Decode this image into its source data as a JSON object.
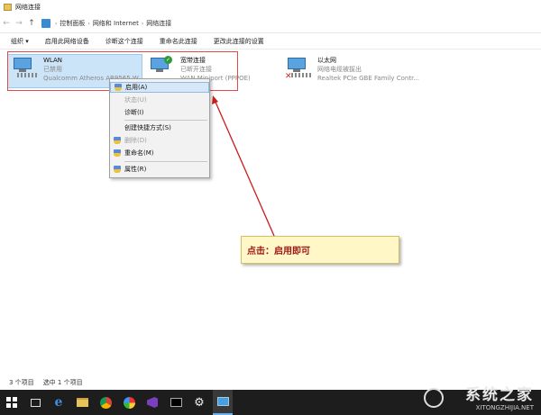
{
  "window": {
    "title": "网络连接"
  },
  "address": {
    "breadcrumbs": [
      "控制面板",
      "网络和 Internet",
      "网络连接"
    ]
  },
  "commands": [
    "组织 ▾",
    "启用此网络设备",
    "诊断这个连接",
    "重命名此连接",
    "更改此连接的设置"
  ],
  "connections": [
    {
      "name": "WLAN",
      "status": "已禁用",
      "device": "Qualcomm Atheros AR9565 W..."
    },
    {
      "name": "宽带连接",
      "status": "已断开连接",
      "device": "WAN Miniport (PPPOE)"
    },
    {
      "name": "以太网",
      "status": "网络电缆被拔出",
      "device": "Realtek PCIe GBE Family Contr..."
    }
  ],
  "context_menu": [
    {
      "label": "启用(A)"
    },
    {
      "label": "状态(U)"
    },
    {
      "label": "诊断(I)"
    },
    {
      "label": "创建快捷方式(S)"
    },
    {
      "label": "删除(D)"
    },
    {
      "label": "重命名(M)"
    },
    {
      "label": "属性(R)"
    }
  ],
  "callout": {
    "text": "点击：启用即可"
  },
  "status_bar": {
    "count": "3 个项目",
    "selected": "选中 1 个项目"
  },
  "watermark": {
    "title": "系统之家",
    "url": "XITONGZHIJIA.NET"
  },
  "colors": {
    "annotation_red": "#e24a4a",
    "callout_bg": "#fff8c6",
    "selection_blue": "#cce4f7"
  }
}
